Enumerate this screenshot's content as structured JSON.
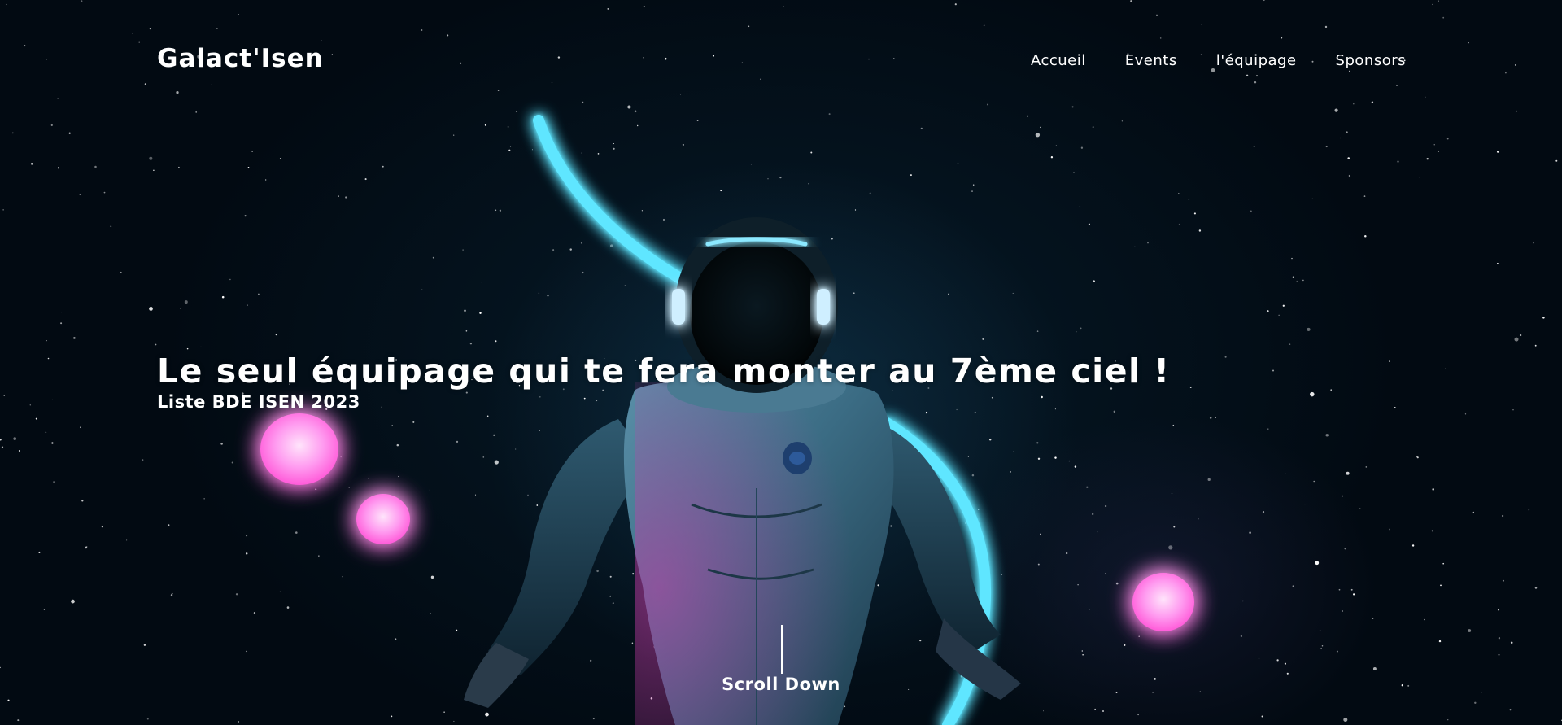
{
  "header": {
    "logo": "Galact'Isen",
    "nav": [
      "Accueil",
      "Events",
      "l'équipage",
      "Sponsors"
    ]
  },
  "hero": {
    "title": "Le seul équipage qui te fera monter au 7ème ciel !",
    "subtitle": "Liste BDE ISEN 2023"
  },
  "scroll": {
    "label": "Scroll Down"
  },
  "colors": {
    "background": "#030d16",
    "neon_cyan": "#5fe6ff",
    "neon_pink": "#ff7ae6",
    "text": "#ffffff"
  },
  "icons": {
    "scroll_indicator": "vertical-line"
  }
}
